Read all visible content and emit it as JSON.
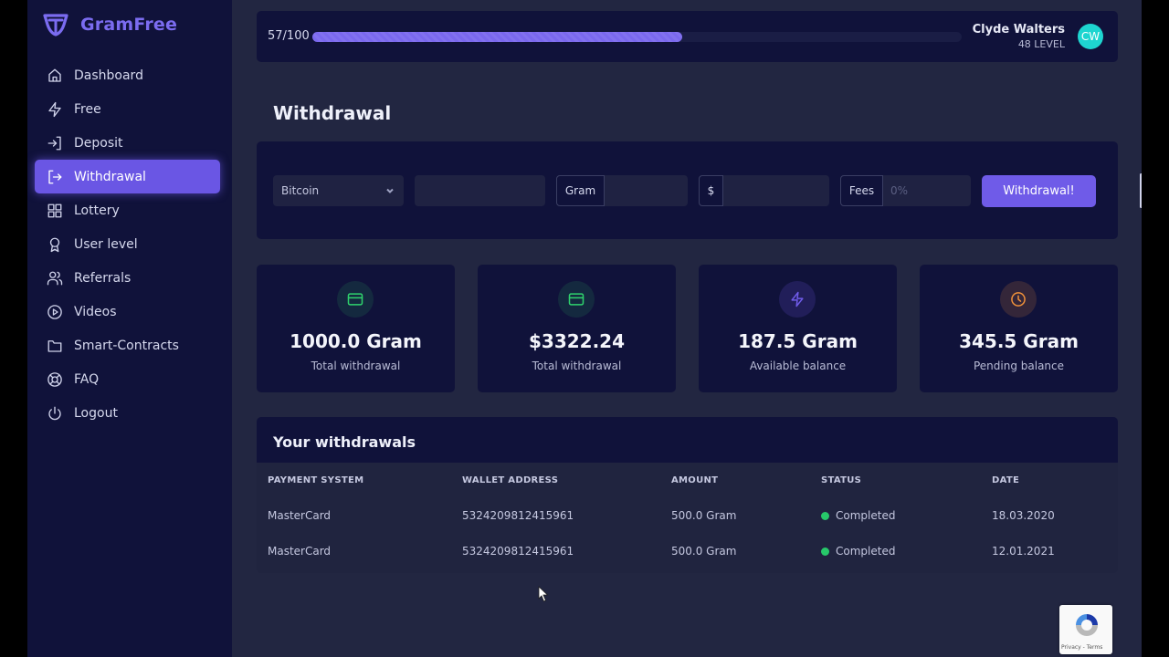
{
  "app": {
    "name": "GramFree"
  },
  "sidebar": {
    "items": [
      {
        "label": "Dashboard",
        "icon": "home-icon"
      },
      {
        "label": "Free",
        "icon": "lightning-icon"
      },
      {
        "label": "Deposit",
        "icon": "login-icon"
      },
      {
        "label": "Withdrawal",
        "icon": "logout-arrow-icon",
        "active": true
      },
      {
        "label": "Lottery",
        "icon": "grid-icon"
      },
      {
        "label": "User level",
        "icon": "award-icon"
      },
      {
        "label": "Referrals",
        "icon": "users-icon"
      },
      {
        "label": "Videos",
        "icon": "play-circle-icon"
      },
      {
        "label": "Smart-Contracts",
        "icon": "folder-icon"
      },
      {
        "label": "FAQ",
        "icon": "lifebuoy-icon"
      },
      {
        "label": "Logout",
        "icon": "power-icon"
      }
    ]
  },
  "topbar": {
    "progress_label": "57/100",
    "progress_fraction": 0.57,
    "user_name": "Clyde Walters",
    "user_level": "48 LEVEL",
    "avatar_initials": "CW",
    "avatar_color": "#1ed5d0"
  },
  "page": {
    "title": "Withdrawal"
  },
  "form": {
    "payment_select_value": "Bitcoin",
    "wallet_value": "",
    "gram_addon": "Gram",
    "gram_value": "",
    "usd_addon": "$",
    "usd_value": "",
    "fees_addon": "Fees",
    "fees_placeholder": "0%",
    "submit_label": "Withdrawal!"
  },
  "stats": [
    {
      "value": "1000.0 Gram",
      "caption": "Total withdrawal",
      "icon": "credit-card-icon",
      "color": "#2fd36d"
    },
    {
      "value": "$3322.24",
      "caption": "Total withdrawal",
      "icon": "credit-card-icon",
      "color": "#2fd36d"
    },
    {
      "value": "187.5 Gram",
      "caption": "Available balance",
      "icon": "lightning-icon",
      "color": "#6f5be8"
    },
    {
      "value": "345.5 Gram",
      "caption": "Pending balance",
      "icon": "clock-icon",
      "color": "#f0913a"
    }
  ],
  "withdrawals": {
    "title": "Your withdrawals",
    "columns": [
      "PAYMENT SYSTEM",
      "WALLET ADDRESS",
      "AMOUNT",
      "STATUS",
      "DATE"
    ],
    "rows": [
      {
        "payment_system": "MasterCard",
        "wallet": "5324209812415961",
        "amount": "500.0 Gram",
        "status": "Completed",
        "date": "18.03.2020"
      },
      {
        "payment_system": "MasterCard",
        "wallet": "5324209812415961",
        "amount": "500.0 Gram",
        "status": "Completed",
        "date": "12.01.2021"
      }
    ],
    "status_color": "#27c86a"
  },
  "recaptcha": {
    "terms_text": "Privacy - Terms"
  }
}
